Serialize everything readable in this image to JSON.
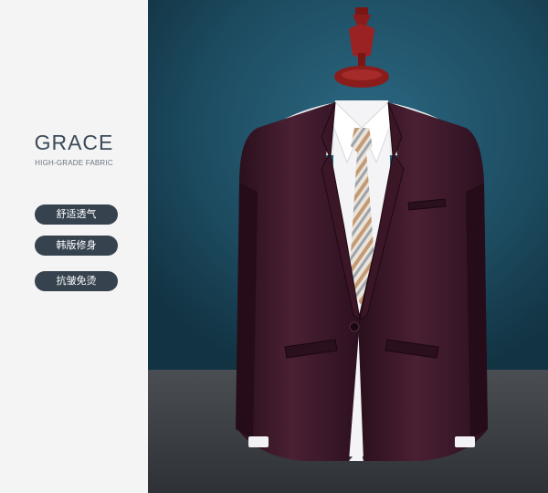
{
  "brand": {
    "title": "GRACE",
    "subtitle": "HIGH-GRADE FABRIC"
  },
  "features": [
    {
      "label": "舒适透气"
    },
    {
      "label": "韩版修身"
    },
    {
      "label": "抗皱免烫"
    }
  ],
  "product_image": {
    "subject": "suit-jacket-on-mannequin",
    "colors": {
      "backdrop": "#1d4c61",
      "floor": "#3b3f44",
      "jacket": "#3a1a2a",
      "shirt": "#f4f4f6",
      "mannequin": "#8a1c1c",
      "tie_stripe_a": "#c39a74",
      "tie_stripe_b": "#9ea4ac"
    }
  }
}
